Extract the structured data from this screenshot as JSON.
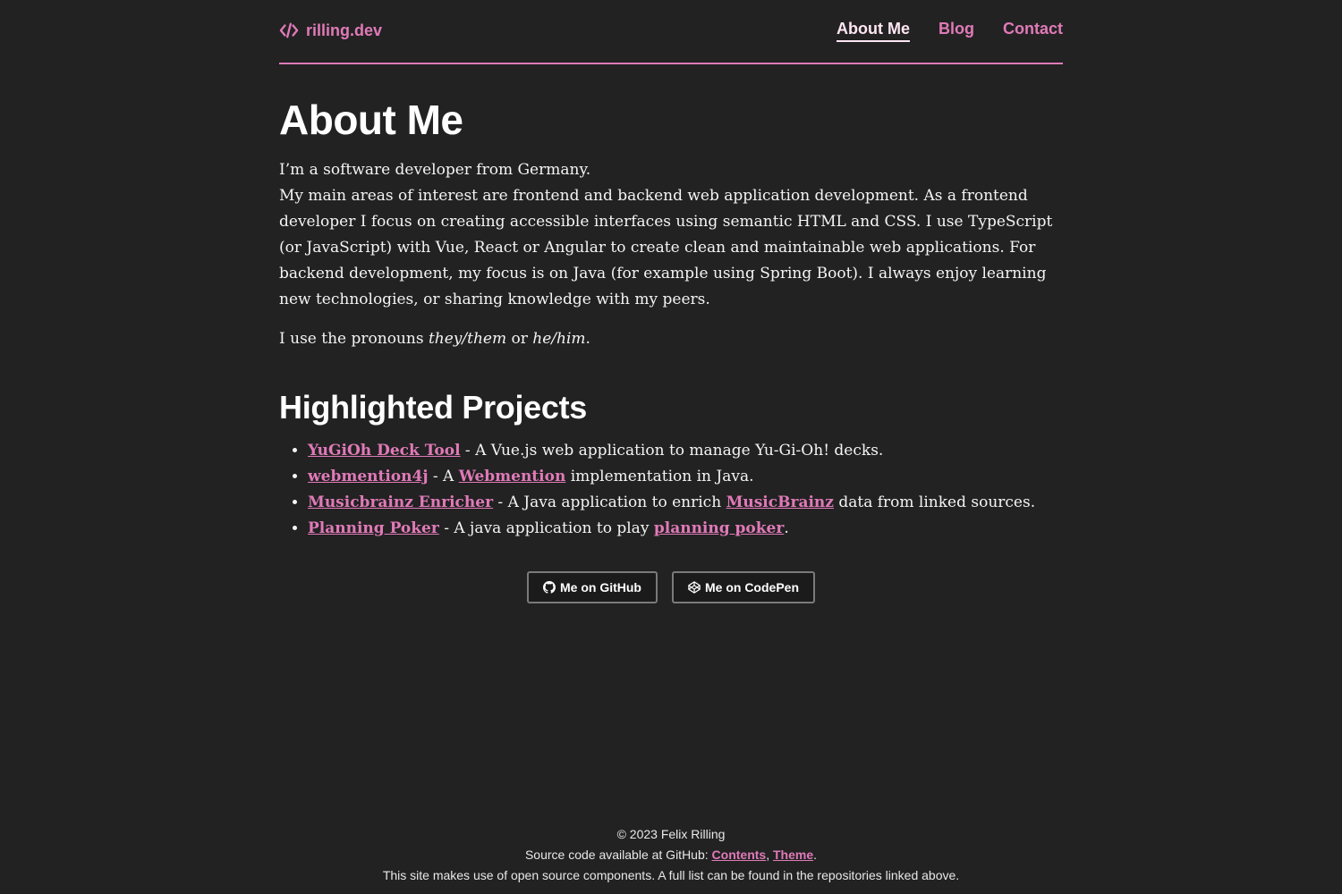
{
  "header": {
    "brand": "rilling.dev",
    "nav": [
      {
        "label": "About Me",
        "active": true
      },
      {
        "label": "Blog",
        "active": false
      },
      {
        "label": "Contact",
        "active": false
      }
    ]
  },
  "main": {
    "title": "About Me",
    "intro_line1": "I’m a software developer from Germany.",
    "intro_line2": "My main areas of interest are frontend and backend web application development. As a frontend developer I focus on creating accessible interfaces using semantic HTML and CSS. I use TypeScript (or JavaScript) with Vue, React or Angular to create clean and maintainable web applications. For backend development, my focus is on Java (for example using Spring Boot). I always enjoy learning new technologies, or sharing knowledge with my peers.",
    "pronouns": {
      "prefix": "I use the pronouns ",
      "first": "they/them",
      "middle": " or ",
      "second": "he/him",
      "suffix": "."
    },
    "projects_title": "Highlighted Projects",
    "projects": [
      {
        "name": "YuGiOh Deck Tool",
        "text1": " - A Vue.js web application to manage Yu-Gi-Oh! decks.",
        "link2": "",
        "text2": ""
      },
      {
        "name": "webmention4j",
        "text1": " - A ",
        "link2": "Webmention",
        "text2": " implementation in Java."
      },
      {
        "name": "Musicbrainz Enricher",
        "text1": " - A Java application to enrich ",
        "link2": "MusicBrainz",
        "text2": " data from linked sources."
      },
      {
        "name": "Planning Poker",
        "text1": " - A java application to play ",
        "link2": "planning poker",
        "text2": "."
      }
    ],
    "buttons": {
      "github": "Me on GitHub",
      "codepen": "Me on CodePen"
    }
  },
  "footer": {
    "copyright": "© 2023 Felix Rilling",
    "source_prefix": "Source code available at GitHub: ",
    "contents_link": "Contents",
    "separator": ", ",
    "theme_link": "Theme",
    "source_suffix": ".",
    "notice": "This site makes use of open source components. A full list can be found in the repositories linked above."
  },
  "colors": {
    "background": "#222222",
    "accent": "#e07ab8",
    "text": "#f4f4f4"
  },
  "icons": {
    "brand": "code-icon",
    "github": "github-icon",
    "codepen": "codepen-icon"
  }
}
